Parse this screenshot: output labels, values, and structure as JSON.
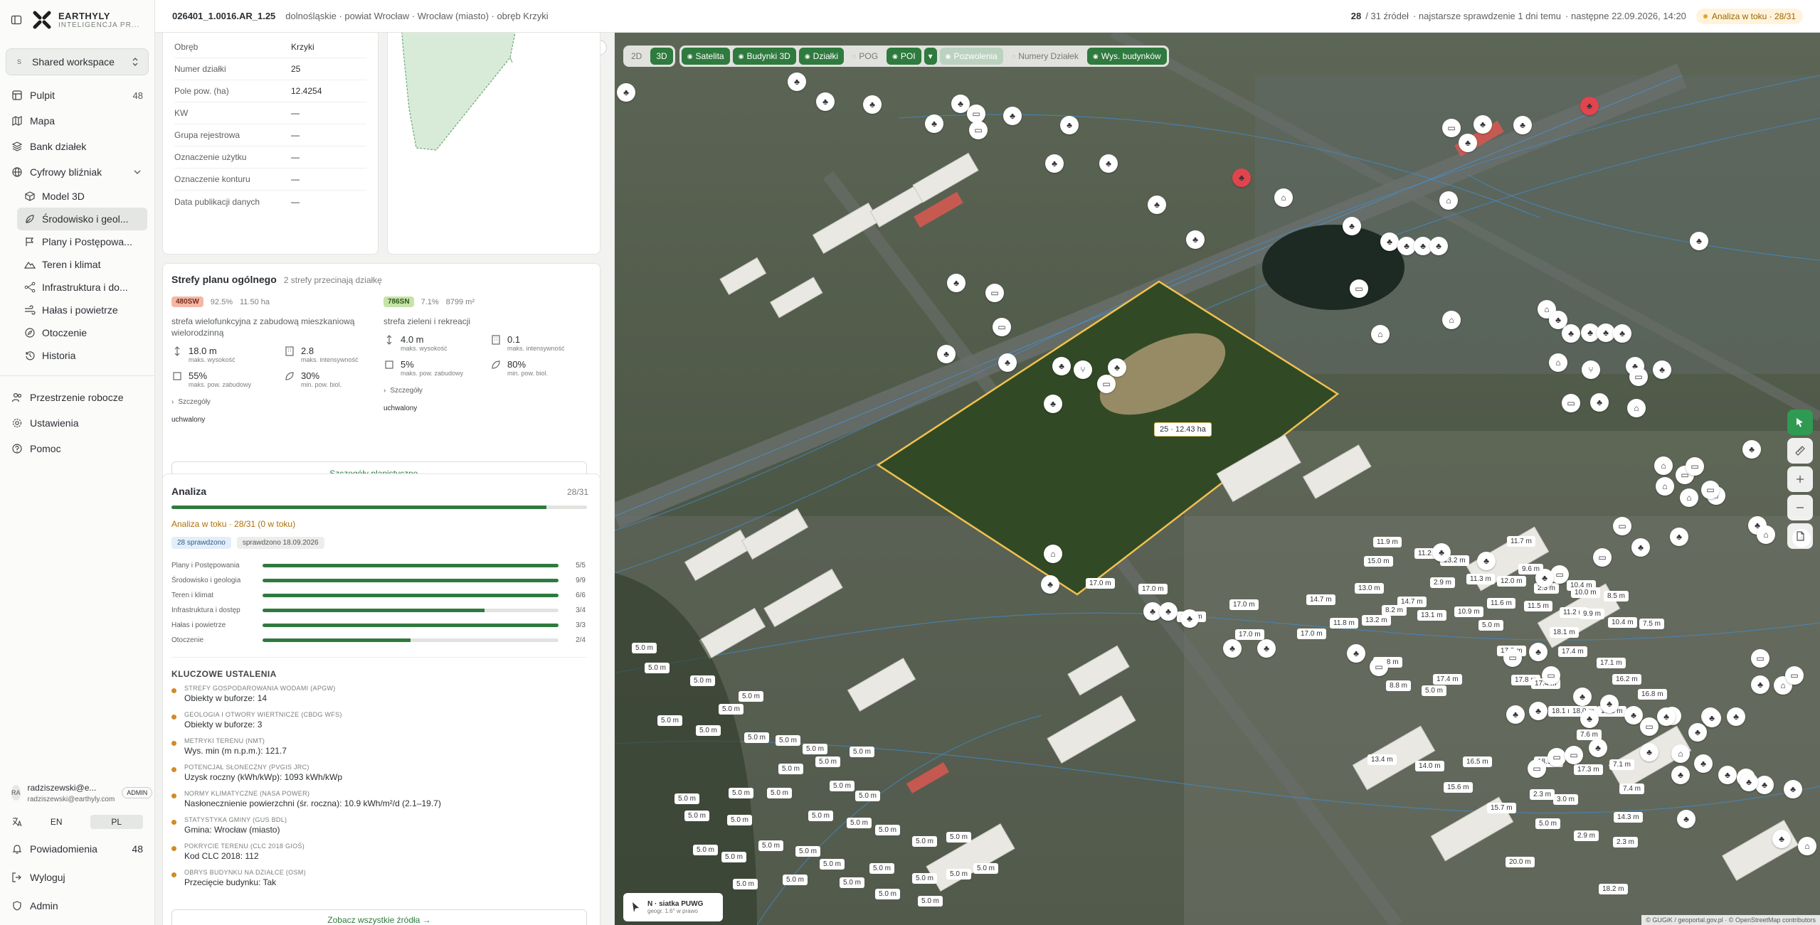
{
  "brand": {
    "name": "EARTHYLY",
    "subtitle": "INTELIGENCJA PR..."
  },
  "workspace": {
    "badge": "S",
    "label": "Shared workspace"
  },
  "nav": {
    "items": [
      {
        "label": "Pulpit",
        "count": "48"
      },
      {
        "label": "Mapa"
      },
      {
        "label": "Bank działek"
      },
      {
        "label": "Cyfrowy bliźniak"
      }
    ],
    "twin_sub": [
      {
        "label": "Model 3D"
      },
      {
        "label": "Środowisko i geol..."
      },
      {
        "label": "Plany i Postępowa..."
      },
      {
        "label": "Teren i klimat"
      },
      {
        "label": "Infrastruktura i do..."
      },
      {
        "label": "Hałas i powietrze"
      },
      {
        "label": "Otoczenie"
      },
      {
        "label": "Historia"
      }
    ],
    "secondary": [
      {
        "label": "Przestrzenie robocze"
      },
      {
        "label": "Ustawienia"
      },
      {
        "label": "Pomoc"
      }
    ]
  },
  "user": {
    "initials": "RA",
    "name": "radziszewski@e...",
    "email": "radziszewski@earthyly.com",
    "role": "ADMIN",
    "lang_en": "EN",
    "lang_pl": "PL",
    "notifications_label": "Powiadomienia",
    "notifications_count": "48",
    "logout_label": "Wyloguj",
    "admin_label": "Admin"
  },
  "topbar": {
    "parcel_id": "026401_1.0016.AR_1.25",
    "breadcrumb": "dolnośląskie · powiat Wrocław · Wrocław (miasto) · obręb Krzyki",
    "sources_count": "28",
    "sources_total": "/ 31 źródeł",
    "latest_check": "· najstarsze sprawdzenie 1 dni temu",
    "next_check": "· następne 22.09.2026, 14:20",
    "status": "Analiza w toku · 28/31"
  },
  "parcel_info": {
    "rows": [
      {
        "k": "Obręb",
        "v": "Krzyki"
      },
      {
        "k": "Numer działki",
        "v": "25"
      },
      {
        "k": "Pole pow. (ha)",
        "v": "12.4254"
      },
      {
        "k": "KW",
        "v": "—"
      },
      {
        "k": "Grupa rejestrowa",
        "v": "—"
      },
      {
        "k": "Oznaczenie użytku",
        "v": "—"
      },
      {
        "k": "Oznaczenie konturu",
        "v": "—"
      },
      {
        "k": "Data publikacji danych",
        "v": "—"
      }
    ]
  },
  "zones": {
    "title": "Strefy planu ogólnego",
    "subtitle": "2 strefy przecinają działkę",
    "details_link": "Szczegóły planistyczne →",
    "items": [
      {
        "tag": "480SW",
        "tag_color": "#f4b7a6",
        "pct": "92.5%",
        "area": "11.50 ha",
        "desc": "strefa wielofunkcyjna z zabudową mieszkaniową wielorodzinną",
        "h": "18.0 m",
        "h_lab": "maks. wysokość",
        "i": "2.8",
        "i_lab": "maks. intensywność",
        "b": "55%",
        "b_lab": "maks. pow. zabudowy",
        "g": "30%",
        "g_lab": "min. pow. biol.",
        "more": "Szczegóły",
        "status": "uchwalony"
      },
      {
        "tag": "786SN",
        "tag_color": "#c6e3a8",
        "pct": "7.1%",
        "area": "8799 m²",
        "desc": "strefa zieleni i rekreacji",
        "h": "4.0 m",
        "h_lab": "maks. wysokość",
        "i": "0.1",
        "i_lab": "maks. intensywność",
        "b": "5%",
        "b_lab": "maks. pow. zabudowy",
        "g": "80%",
        "g_lab": "min. pow. biol.",
        "more": "Szczegóły",
        "status": "uchwalony"
      }
    ]
  },
  "analysis": {
    "title": "Analiza",
    "count": "28/31",
    "progress": 0.903,
    "status_text": "Analiza w toku · 28/31 (0 w toku)",
    "chip_checked": "28 sprawdzono",
    "chip_date": "sprawdzono 18.09.2026",
    "categories": [
      {
        "label": "Plany i Postępowania",
        "done": 5,
        "total": 5,
        "count": "5/5"
      },
      {
        "label": "Środowisko i geologia",
        "done": 9,
        "total": 9,
        "count": "9/9"
      },
      {
        "label": "Teren i klimat",
        "done": 6,
        "total": 6,
        "count": "6/6"
      },
      {
        "label": "Infrastruktura i dostęp",
        "done": 3,
        "total": 4,
        "count": "3/4"
      },
      {
        "label": "Hałas i powietrze",
        "done": 3,
        "total": 3,
        "count": "3/3"
      },
      {
        "label": "Otoczenie",
        "done": 2,
        "total": 4,
        "count": "2/4"
      }
    ],
    "findings_title": "KLUCZOWE USTALENIA",
    "findings": [
      {
        "t": "STREFY GOSPODAROWANIA WODAMI (APGW)",
        "v": "Obiekty w buforze: 14"
      },
      {
        "t": "GEOLOGIA I OTWORY WIERTNICZE (CBDG WFS)",
        "v": "Obiekty w buforze: 3"
      },
      {
        "t": "METRYKI TERENU (NMT)",
        "v": "Wys. min (m n.p.m.): 121.7"
      },
      {
        "t": "POTENCJAŁ SŁONECZNY (PVGIS JRC)",
        "v": "Uzysk roczny (kWh/kWp): 1093 kWh/kWp"
      },
      {
        "t": "NORMY KLIMATYCZNE (NASA POWER)",
        "v": "Nasłonecznienie powierzchni (śr. roczna): 10.9 kWh/m²/d (2.1–19.7)"
      },
      {
        "t": "STATYSTYKA GMINY (GUS BDL)",
        "v": "Gmina: Wrocław (miasto)"
      },
      {
        "t": "POKRYCIE TERENU (CLC 2018 GIOŚ)",
        "v": "Kod CLC 2018: 112"
      },
      {
        "t": "OBRYS BUDYNKU NA DZIAŁCE (OSM)",
        "v": "Przecięcie budynku: Tak"
      }
    ],
    "all_sources_link": "Zobacz wszystkie źródła →"
  },
  "map": {
    "toolbar": {
      "mode_2d": "2D",
      "mode_3d": "3D",
      "layers": [
        {
          "label": "Satelita",
          "state": "on"
        },
        {
          "label": "Budynki 3D",
          "state": "on"
        },
        {
          "label": "Działki",
          "state": "on"
        },
        {
          "label": "POG",
          "state": "off"
        },
        {
          "label": "POI",
          "state": "on"
        },
        {
          "label": "Pozwolenia",
          "state": "faded"
        },
        {
          "label": "Numery Działek",
          "state": "off"
        },
        {
          "label": "Wys. budynków",
          "state": "on"
        }
      ]
    },
    "parcel_label": "25 · 12.43 ha",
    "height_labels": [
      "17.0 m",
      "17.0 m",
      "17.0 m",
      "17.0 m",
      "17.0 m",
      "17.0 m",
      "15.0 m",
      "11.9 m",
      "11.2 m",
      "13.2 m",
      "11.7 m",
      "9.6 m",
      "10.4 m",
      "14.7 m",
      "13.0 m",
      "14.7 m",
      "2.9 m",
      "11.3 m",
      "12.0 m",
      "2.3 m",
      "10.0 m",
      "8.5 m",
      "13.1 m",
      "8.2 m",
      "10.9 m",
      "11.6 m",
      "11.5 m",
      "11.2 m",
      "9.9 m",
      "10.4 m",
      "7.5 m",
      "11.8 m",
      "13.2 m",
      "5.0 m",
      "18.1 m",
      "17.8 m",
      "17.4 m",
      "17.1 m",
      "16.2 m",
      "15.8 m",
      "17.4 m",
      "17.8 m",
      "17.4 m",
      "16.8 m",
      "8.8 m",
      "5.0 m",
      "18.1 m",
      "18.0 m",
      "17.8 m",
      "7.6 m",
      "13.4 m",
      "14.0 m",
      "16.5 m",
      "18.1 m",
      "17.3 m",
      "7.1 m",
      "15.6 m",
      "15.7 m",
      "2.3 m",
      "3.0 m",
      "7.4 m",
      "14.3 m",
      "5.0 m",
      "2.9 m",
      "20.0 m",
      "2.3 m",
      "18.2 m"
    ],
    "small_label": "5.0 m",
    "compass_title": "N · siatka PUWG",
    "compass_sub": "geogr. 1.6° w prawo",
    "attribution": "© GUGiK / geoportal.gov.pl · © OpenStreetMap contributors",
    "colors": {
      "accent": "#2f7a3e",
      "parcel": "#f2c14e",
      "warning": "#e8a12a"
    }
  }
}
